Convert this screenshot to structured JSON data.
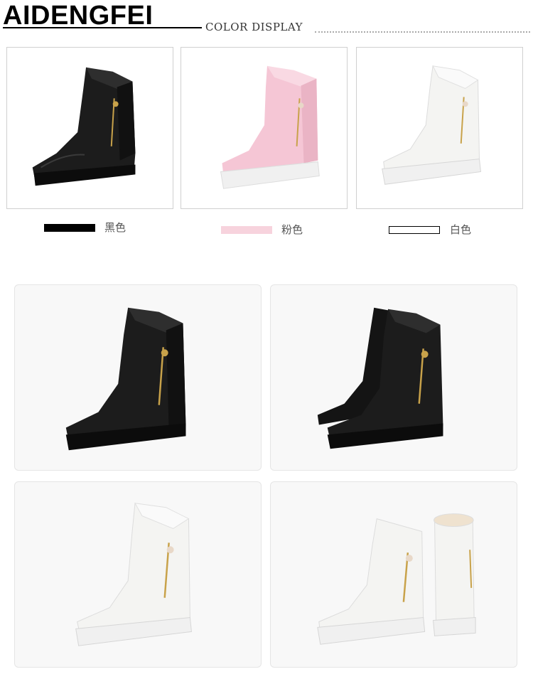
{
  "header": {
    "brand": "AIDENGFEI",
    "section_title": "COLOR DISPLAY"
  },
  "colors": [
    {
      "label": "黑色",
      "swatch": "#000000",
      "boot": "black-boot"
    },
    {
      "label": "粉色",
      "swatch": "#f7d3dd",
      "boot": "pink-boot"
    },
    {
      "label": "白色",
      "swatch": "#ffffff",
      "boot": "white-boot"
    }
  ],
  "palette": {
    "black_leather": "#1c1c1c",
    "pink_leather": "#f5c6d5",
    "white_leather": "#f4f4f2",
    "sole_white": "#f0f0f0",
    "zipper_gold": "#c8a24a",
    "panel_bg": "#f8f8f8"
  },
  "gallery": [
    {
      "name": "black-boot-side-view"
    },
    {
      "name": "black-boot-pair-view"
    },
    {
      "name": "white-boot-side-view"
    },
    {
      "name": "white-boot-pair-view"
    }
  ]
}
